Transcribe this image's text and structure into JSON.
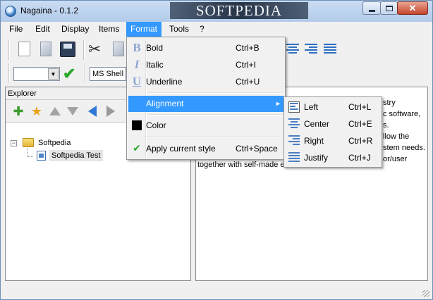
{
  "window": {
    "title": "Nagaina - 0.1.2",
    "watermark": "SOFTPEDIA",
    "close_glyph": "✕"
  },
  "menubar": {
    "items": [
      {
        "label": "File"
      },
      {
        "label": "Edit"
      },
      {
        "label": "Display"
      },
      {
        "label": "Items"
      },
      {
        "label": "Format"
      },
      {
        "label": "Tools"
      },
      {
        "label": "?"
      }
    ]
  },
  "toolbar": {
    "font_name": "MS Shell D",
    "combo_value": ""
  },
  "explorer": {
    "title": "Explorer",
    "tree": [
      {
        "label": "Softpedia",
        "expander": "−"
      },
      {
        "label": "Softpedia Test"
      }
    ]
  },
  "content": {
    "lines_visible": [
      "stry",
      "c software,",
      "s.",
      "llow the",
      "stem needs.",
      "or/user",
      "together with self-made e"
    ]
  },
  "format_menu": {
    "items": [
      {
        "label": "Bold",
        "shortcut": "Ctrl+B",
        "icon": "B"
      },
      {
        "label": "Italic",
        "shortcut": "Ctrl+I",
        "icon": "I"
      },
      {
        "label": "Underline",
        "shortcut": "Ctrl+U",
        "icon": "U"
      },
      {
        "label": "Alignment",
        "submenu_arrow": "►"
      },
      {
        "label": "Color"
      },
      {
        "label": "Apply current style",
        "shortcut": "Ctrl+Space",
        "icon": "✔"
      }
    ]
  },
  "alignment_menu": {
    "items": [
      {
        "label": "Left",
        "shortcut": "Ctrl+L"
      },
      {
        "label": "Center",
        "shortcut": "Ctrl+E"
      },
      {
        "label": "Right",
        "shortcut": "Ctrl+R"
      },
      {
        "label": "Justify",
        "shortcut": "Ctrl+J"
      }
    ]
  },
  "colors": {
    "menu_highlight": "#3399ff",
    "check_green": "#29a82a",
    "accent_blue": "#2e78d6"
  }
}
